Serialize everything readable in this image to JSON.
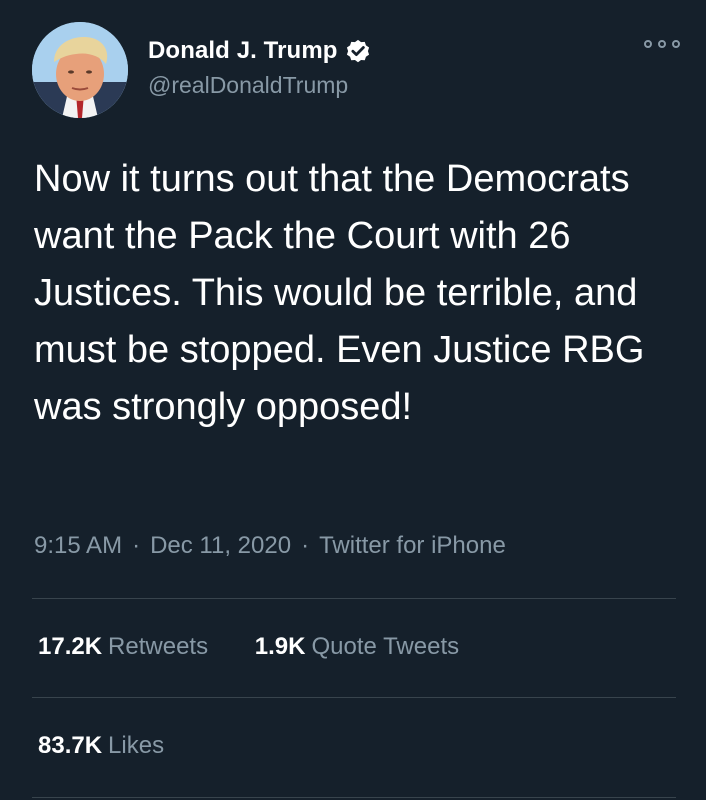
{
  "tweet": {
    "author": {
      "display_name": "Donald J. Trump",
      "handle": "@realDonaldTrump",
      "verified": true
    },
    "more_icon": "more-options-icon",
    "text": "Now it turns out that the Democrats want the Pack the Court with 26 Justices. This would be terrible, and must be stopped. Even Justice RBG was strongly opposed!",
    "meta": {
      "time": "9:15 AM",
      "separator": "·",
      "date": "Dec 11, 2020",
      "source": "Twitter for iPhone"
    },
    "stats": {
      "retweets": {
        "count": "17.2K",
        "label": "Retweets"
      },
      "quote_tweets": {
        "count": "1.9K",
        "label": "Quote Tweets"
      },
      "likes": {
        "count": "83.7K",
        "label": "Likes"
      }
    }
  },
  "colors": {
    "background": "#15202b",
    "text_primary": "#ffffff",
    "text_secondary": "#8899a6",
    "divider": "#38444d"
  }
}
